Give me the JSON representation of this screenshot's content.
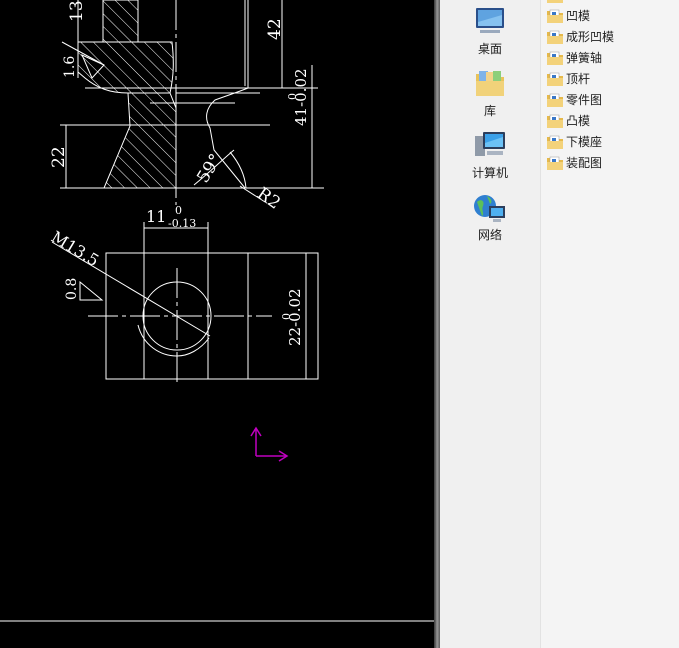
{
  "nav": [
    {
      "label": "桌面",
      "icon": "desktop-icon"
    },
    {
      "label": "库",
      "icon": "library-icon"
    },
    {
      "label": "计算机",
      "icon": "computer-icon"
    },
    {
      "label": "网络",
      "icon": "network-icon"
    }
  ],
  "files": [
    "凹模",
    "成形凹模",
    "弹簧轴",
    "顶杆",
    "零件图",
    "凸模",
    "下模座",
    "装配图"
  ],
  "drawing": {
    "dim_13": "13",
    "dim_42": "42",
    "roughness_top": "1.6",
    "tol_41_upper": "0",
    "tol_41": "41-0.02",
    "dim_22_left": "22",
    "angle_59": "59°",
    "radius_r2": "R2",
    "dim_11": "11",
    "tol_11_upper": "0",
    "tol_11_lower": "-0.13",
    "thread_m13": "M13.5",
    "roughness_bottom": "0.8",
    "tol_22_upper": "0",
    "tol_22": "22-0.02"
  },
  "colors": {
    "cad_bg": "#000000",
    "cad_lines": "#ffffff",
    "ucs_icon": "#c000c0"
  }
}
